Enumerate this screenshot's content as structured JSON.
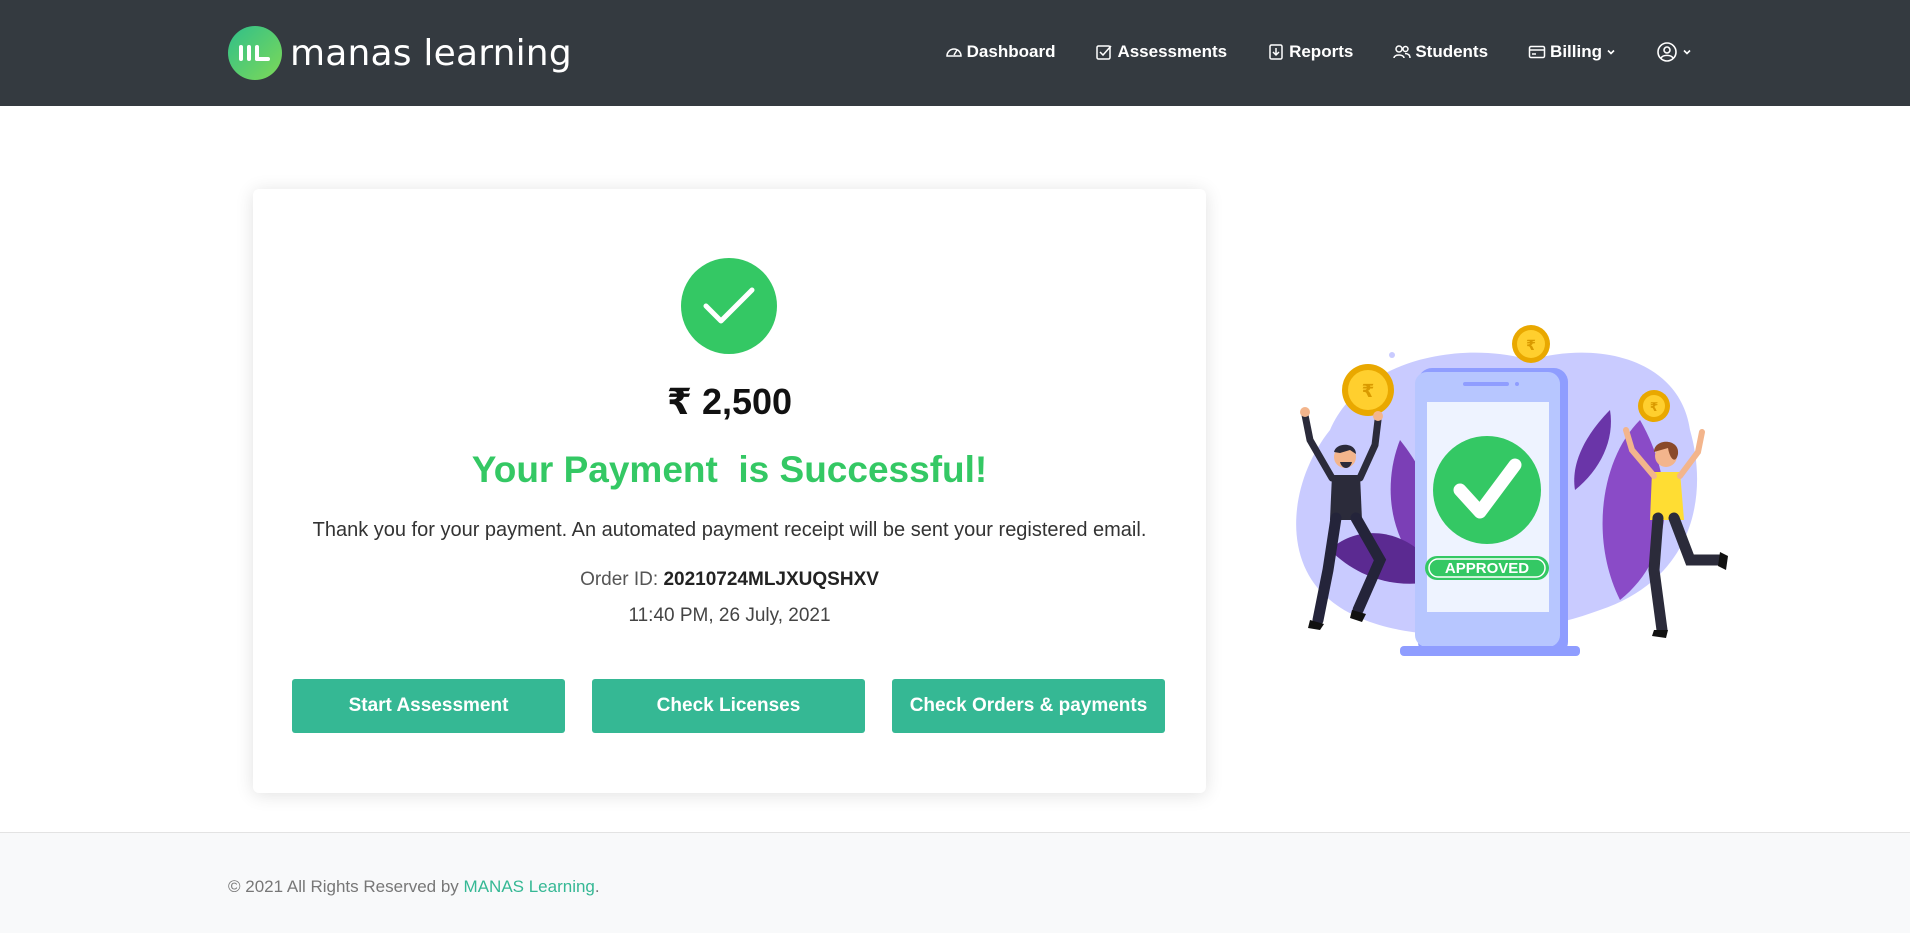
{
  "brand": {
    "name": "manas learning"
  },
  "nav": {
    "items": [
      {
        "label": "Dashboard",
        "icon": "speedometer-icon"
      },
      {
        "label": "Assessments",
        "icon": "checkbox-icon"
      },
      {
        "label": "Reports",
        "icon": "download-doc-icon"
      },
      {
        "label": "Students",
        "icon": "people-icon"
      },
      {
        "label": "Billing",
        "icon": "credit-card-icon"
      }
    ],
    "user_icon": "user-circle-icon"
  },
  "payment": {
    "amount": "₹ 2,500",
    "headline": "Your Payment  is Successful!",
    "message": "Thank you for your payment. An automated payment receipt will be sent your registered email.",
    "order_label": "Order ID: ",
    "order_id": "20210724MLJXUQSHXV",
    "datetime": "11:40 PM, 26 July, 2021"
  },
  "actions": {
    "start": "Start Assessment",
    "licenses": "Check Licenses",
    "orders": "Check Orders & payments"
  },
  "illustration": {
    "badge": "APPROVED"
  },
  "footer": {
    "prefix": "© 2021 All Rights Reserved by ",
    "link": "MANAS Learning",
    "suffix": "."
  },
  "colors": {
    "topbar": "#343a40",
    "success": "#34c864",
    "button": "#35b894",
    "footer_bg": "#f8f9fa"
  }
}
